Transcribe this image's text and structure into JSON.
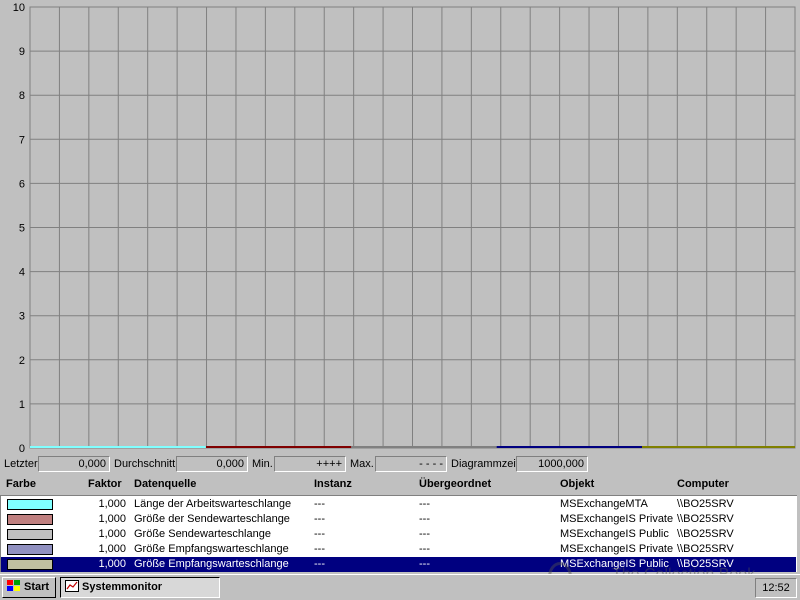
{
  "chart": {
    "y_ticks": [
      "0",
      "1",
      "2",
      "3",
      "4",
      "5",
      "6",
      "7",
      "8",
      "9",
      "10"
    ],
    "y_range": [
      0,
      10
    ],
    "vertical_grid_lines": 26,
    "background": "#c0c0c0",
    "grid_color": "#808080",
    "series_segments": [
      {
        "color": "#80ffff",
        "from": 0.0,
        "to": 0.23
      },
      {
        "color": "#800000",
        "from": 0.23,
        "to": 0.42
      },
      {
        "color": "#808080",
        "from": 0.42,
        "to": 0.61
      },
      {
        "color": "#000080",
        "from": 0.61,
        "to": 0.8
      },
      {
        "color": "#808000",
        "from": 0.8,
        "to": 1.0
      }
    ]
  },
  "stats": {
    "last_label": "Letzter",
    "last_value": "0,000",
    "avg_label": "Durchschnitt",
    "avg_value": "0,000",
    "min_label": "Min.",
    "min_value": "++++",
    "max_label": "Max.",
    "max_value": "- - - -",
    "time_label": "Diagrammzeit",
    "time_value": "1000,000"
  },
  "legend": {
    "headers": {
      "color": "Farbe",
      "factor": "Faktor",
      "source": "Datenquelle",
      "instance": "Instanz",
      "parent": "Übergeordnet",
      "object": "Objekt",
      "computer": "Computer"
    },
    "rows": [
      {
        "swatch": "#80ffff",
        "factor": "1,000",
        "source": "Länge der Arbeitswarteschlange",
        "instance": "---",
        "parent": "---",
        "object": "MSExchangeMTA",
        "computer": "\\\\BO25SRV"
      },
      {
        "swatch": "#c08080",
        "factor": "1,000",
        "source": "Größe der Sendewarteschlange",
        "instance": "---",
        "parent": "---",
        "object": "MSExchangeIS Private",
        "computer": "\\\\BO25SRV"
      },
      {
        "swatch": "#c0c0c0",
        "factor": "1,000",
        "source": "Größe Sendewarteschlange",
        "instance": "---",
        "parent": "---",
        "object": "MSExchangeIS Public",
        "computer": "\\\\BO25SRV"
      },
      {
        "swatch": "#9090c0",
        "factor": "1,000",
        "source": "Größe Empfangswarteschlange",
        "instance": "---",
        "parent": "---",
        "object": "MSExchangeIS Private",
        "computer": "\\\\BO25SRV"
      },
      {
        "swatch": "#c0c0a0",
        "factor": "1,000",
        "source": "Größe Empfangswarteschlange",
        "instance": "---",
        "parent": "---",
        "object": "MSExchangeIS Public",
        "computer": "\\\\BO25SRV",
        "selected": true
      }
    ]
  },
  "taskbar": {
    "start_label": "Start",
    "task_label": "Systemmonitor",
    "clock": "12:52"
  },
  "watermark": "The Collection Book"
}
